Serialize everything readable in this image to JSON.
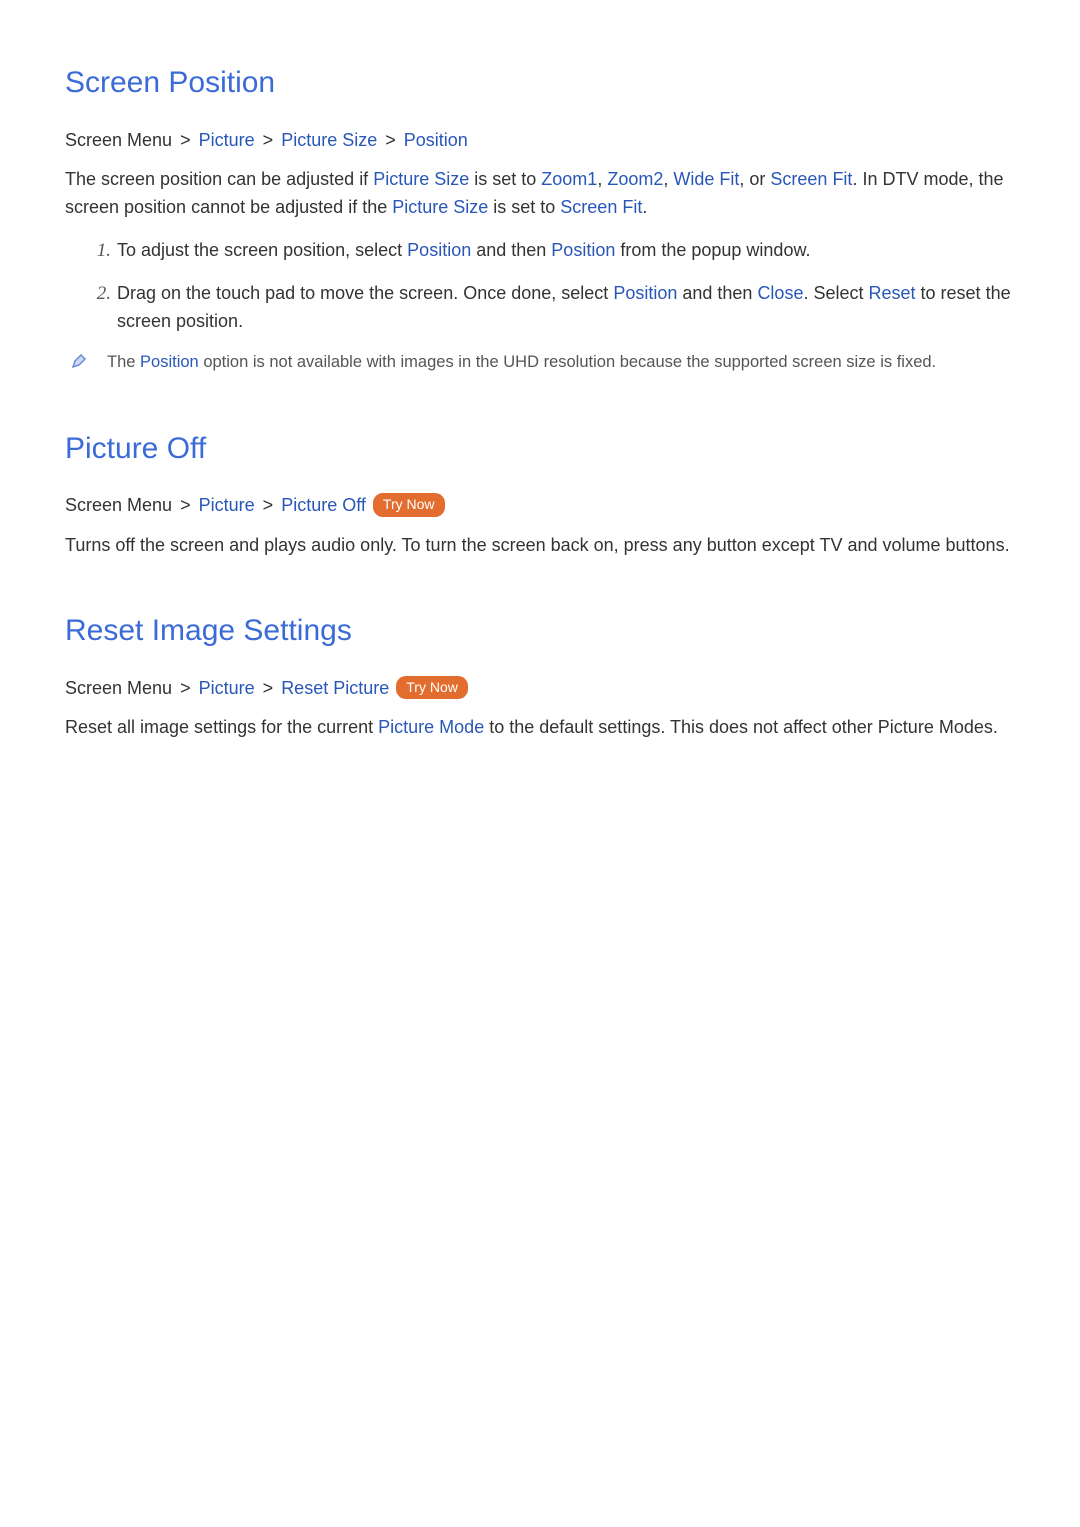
{
  "section1": {
    "title": "Screen Position",
    "bc1": "Screen Menu",
    "bc2": "Picture",
    "bc3": "Picture Size",
    "bc4": "Position",
    "p1a": "The screen position can be adjusted if ",
    "ps": "Picture Size",
    "p1b": " is set to ",
    "z1": "Zoom1",
    "comma1": ", ",
    "z2": "Zoom2",
    "comma2": ", ",
    "wf": "Wide Fit",
    "p1c": ", or ",
    "sf": "Screen Fit",
    "p1d": ". In DTV mode, the screen position cannot be adjusted if the ",
    "ps2": "Picture Size",
    "p1e": " is set to ",
    "sf2": "Screen Fit",
    "p1f": ".",
    "li1a": "To adjust the screen position, select ",
    "pos1": "Position",
    "li1b": " and then ",
    "pos2": "Position",
    "li1c": " from the popup window.",
    "li2a": "Drag on the touch pad to move the screen. Once done, select ",
    "pos3": "Position",
    "li2b": " and then ",
    "close": "Close",
    "li2c": ". Select ",
    "reset": "Reset",
    "li2d": " to reset the screen position.",
    "note_a": "The ",
    "note_pos": "Position",
    "note_b": " option is not available with images in the UHD resolution because the supported screen size is fixed."
  },
  "section2": {
    "title": "Picture Off",
    "bc1": "Screen Menu",
    "bc2": "Picture",
    "bc3": "Picture Off",
    "try": "Try Now",
    "p1": "Turns off the screen and plays audio only. To turn the screen back on, press any button except TV and volume buttons."
  },
  "section3": {
    "title": "Reset Image Settings",
    "bc1": "Screen Menu",
    "bc2": "Picture",
    "bc3": "Reset Picture",
    "try": "Try Now",
    "p1a": "Reset all image settings for the current ",
    "pm": "Picture Mode",
    "p1b": " to the default settings. This does not affect other Picture Modes."
  }
}
